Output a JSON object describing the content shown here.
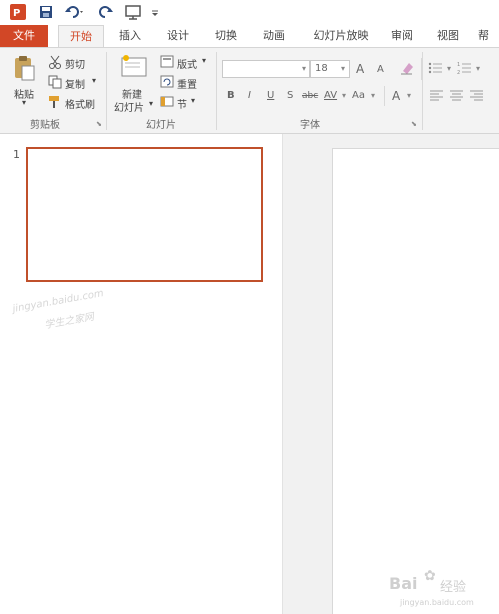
{
  "qat": {
    "icons": [
      "powerpoint-logo-icon",
      "save-icon",
      "undo-icon",
      "redo-icon",
      "start-slideshow-icon",
      "customize-qat-icon"
    ]
  },
  "tabs": {
    "file": "文件",
    "items": [
      "开始",
      "插入",
      "设计",
      "切换",
      "动画",
      "幻灯片放映",
      "审阅",
      "视图",
      "帮"
    ]
  },
  "clipboard": {
    "paste": "粘贴",
    "cut": "剪切",
    "copy": "复制",
    "format_painter": "格式刷",
    "group_label": "剪贴板"
  },
  "slides_group": {
    "new_slide_line1": "新建",
    "new_slide_line2": "幻灯片",
    "layout": "版式",
    "reset": "重置",
    "section": "节",
    "group_label": "幻灯片"
  },
  "font": {
    "font_size": "18",
    "grow": "A",
    "shrink": "A",
    "bold": "B",
    "italic": "I",
    "underline": "U",
    "strikethrough": "S",
    "shadow_abc": "abc",
    "char_spacing": "AV",
    "change_case": "Aa",
    "font_color": "A",
    "group_label": "字体"
  },
  "thumbnails": {
    "slide_number": "1"
  },
  "watermarks": {
    "top_left": "jingyan.baidu.com",
    "top_left_cn": "学生之家网",
    "bottom_right_logo": "Bai",
    "bottom_right_cn": "经验",
    "bottom_right_url": "jingyan.baidu.com"
  }
}
